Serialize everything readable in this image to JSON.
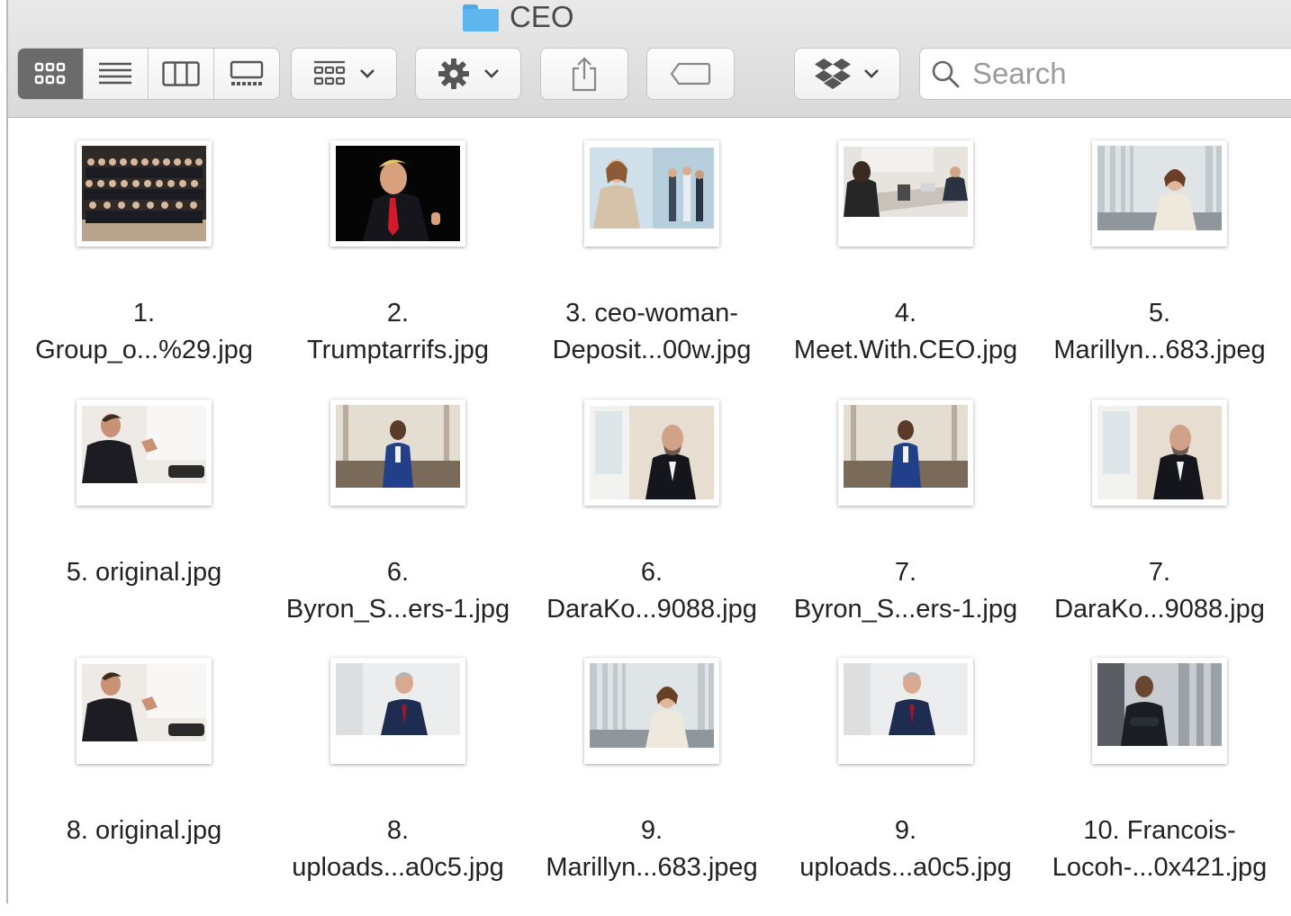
{
  "window": {
    "title": "CEO"
  },
  "toolbar": {
    "view_buttons": [
      "icon-view-icon",
      "list-view-icon",
      "column-view-icon",
      "gallery-view-icon"
    ],
    "group_button_icon": "group-grid-icon",
    "action_button_icon": "gear-icon",
    "share_button_icon": "share-icon",
    "tag_button_icon": "tag-icon",
    "dropbox_button_icon": "dropbox-icon",
    "search": {
      "placeholder": "Search",
      "value": ""
    }
  },
  "files": [
    {
      "name": "1.\nGroup_o...%29.jpg"
    },
    {
      "name": "2.\nTrumptarrifs.jpg"
    },
    {
      "name": "3. ceo-woman-\nDeposit...00w.jpg"
    },
    {
      "name": "4.\nMeet.With.CEO.jpg"
    },
    {
      "name": "5.\nMarillyn...683.jpeg"
    },
    {
      "name": "5. original.jpg"
    },
    {
      "name": "6.\nByron_S...ers-1.jpg"
    },
    {
      "name": "6.\nDaraKo...9088.jpg"
    },
    {
      "name": "7.\nByron_S...ers-1.jpg"
    },
    {
      "name": "7.\nDaraKo...9088.jpg"
    },
    {
      "name": "8. original.jpg"
    },
    {
      "name": "8.\nuploads...a0c5.jpg"
    },
    {
      "name": "9.\nMarillyn...683.jpeg"
    },
    {
      "name": "9.\nuploads...a0c5.jpg"
    },
    {
      "name": "10. Francois-\nLocoh-...0x421.jpg"
    }
  ]
}
